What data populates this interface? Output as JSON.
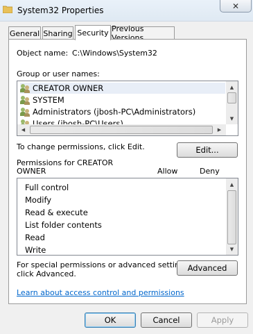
{
  "window": {
    "title": "System32 Properties",
    "close_glyph": "✕"
  },
  "tabs": [
    {
      "label": "General"
    },
    {
      "label": "Sharing"
    },
    {
      "label": "Security"
    },
    {
      "label": "Previous Versions"
    }
  ],
  "object_name": {
    "label": "Object name:",
    "value": "C:\\Windows\\System32"
  },
  "groups": {
    "label": "Group or user names:",
    "items": [
      {
        "label": "CREATOR OWNER"
      },
      {
        "label": "SYSTEM"
      },
      {
        "label": "Administrators (jbosh-PC\\Administrators)"
      },
      {
        "label": "Users (jbosh-PC\\Users)"
      }
    ],
    "selected_index": 0
  },
  "change_permissions": {
    "text": "To change permissions, click Edit.",
    "edit_button": "Edit..."
  },
  "permissions": {
    "title_line1": "Permissions for CREATOR",
    "title_line2": "OWNER",
    "allow_header": "Allow",
    "deny_header": "Deny",
    "items": [
      {
        "label": "Full control"
      },
      {
        "label": "Modify"
      },
      {
        "label": "Read & execute"
      },
      {
        "label": "List folder contents"
      },
      {
        "label": "Read"
      },
      {
        "label": "Write"
      }
    ]
  },
  "special": {
    "line1": "For special permissions or advanced settings,",
    "line2": "click Advanced.",
    "advanced_button": "Advanced"
  },
  "learn_link": "Learn about access control and permissions",
  "footer": {
    "ok": "OK",
    "cancel": "Cancel",
    "apply": "Apply"
  }
}
